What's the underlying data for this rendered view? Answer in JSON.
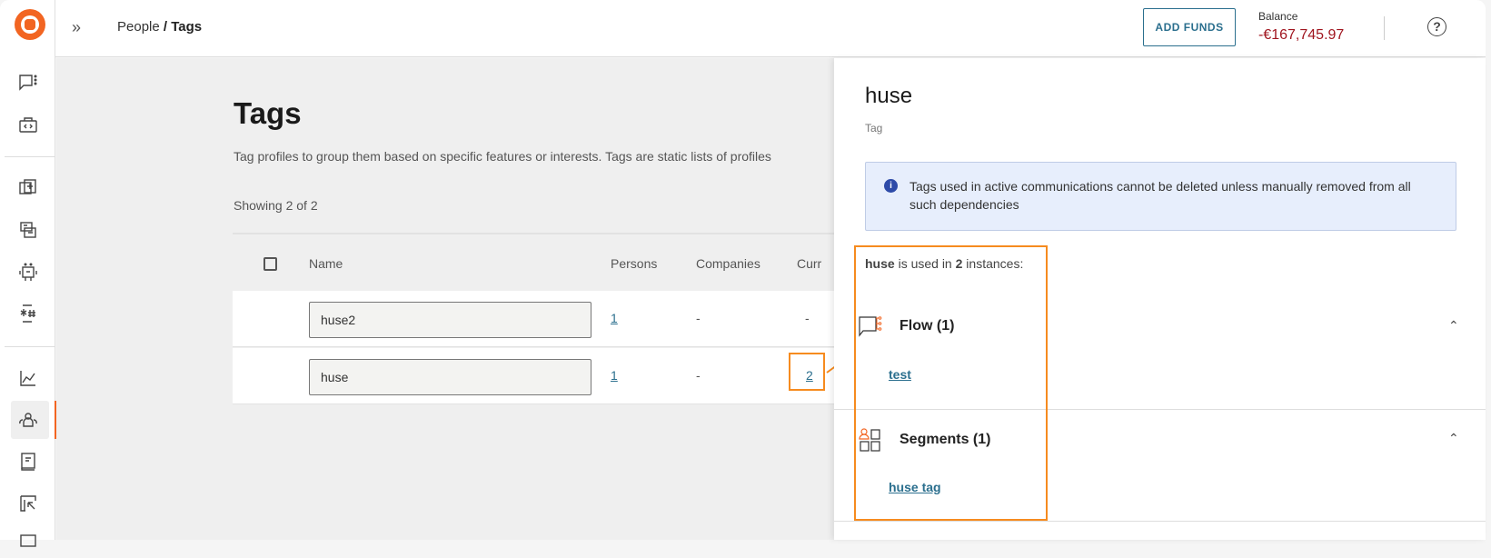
{
  "header": {
    "breadcrumb_parent": "People",
    "breadcrumb_sep": " / ",
    "breadcrumb_current": "Tags",
    "add_funds": "ADD FUNDS",
    "balance_label": "Balance",
    "balance_value": "-€167,745.97"
  },
  "sidebar": {
    "items": [
      {
        "icon": "chat-icon"
      },
      {
        "icon": "code-icon"
      },
      {
        "icon": "templates-icon"
      },
      {
        "icon": "forms-icon"
      },
      {
        "icon": "bot-icon"
      },
      {
        "icon": "keywords-icon"
      },
      {
        "icon": "analytics-icon"
      },
      {
        "icon": "people-icon",
        "active": true
      },
      {
        "icon": "book-icon"
      },
      {
        "icon": "import-icon"
      }
    ]
  },
  "main": {
    "title": "Tags",
    "description": "Tag profiles to group them based on specific features or interests. Tags are static lists of profiles",
    "showing": "Showing 2 of 2",
    "columns": [
      "Name",
      "Persons",
      "Companies",
      "Curr"
    ],
    "rows": [
      {
        "name": "huse2",
        "persons": "1",
        "companies": "-",
        "current": "-"
      },
      {
        "name": "huse",
        "persons": "1",
        "companies": "-",
        "current": "2"
      }
    ]
  },
  "panel": {
    "title": "huse",
    "subtitle": "Tag",
    "info": "Tags used in active communications cannot be deleted unless manually removed from all such dependencies",
    "used_name": "huse",
    "used_mid": " is used in ",
    "used_count": "2",
    "used_end": " instances:",
    "sections": [
      {
        "title": "Flow (1)",
        "items": [
          "test"
        ]
      },
      {
        "title": "Segments (1)",
        "items": [
          "huse tag"
        ]
      }
    ]
  },
  "colors": {
    "brand": "#f26522",
    "link": "#2b6f8e",
    "balance": "#a0151f",
    "highlight": "#f68b1f",
    "info_bg": "#e7eefc"
  }
}
